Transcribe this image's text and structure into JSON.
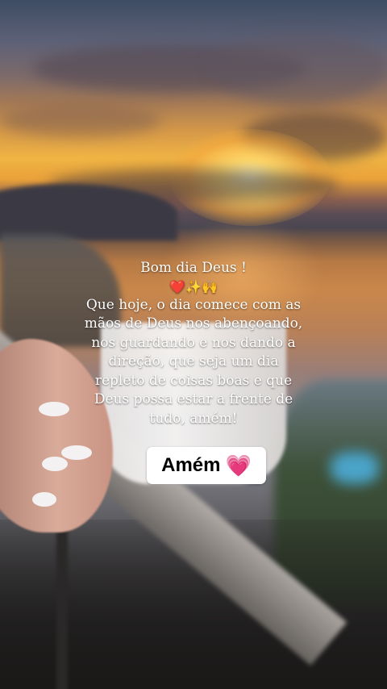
{
  "message": {
    "greeting": "Bom dia Deus !",
    "emojis": {
      "heart": "❤️",
      "sparkles": "✨",
      "raised_hands": "🙌"
    },
    "lines": [
      "Que hoje, o dia comece com as",
      "mãos de Deus nos abençoando,",
      "nos guardando e nos dando a",
      "direção, que seja um dia",
      "repleto de coisas boas e que",
      "Deus possa estar a frente de",
      "tudo, amém!"
    ]
  },
  "amem_button": {
    "label": "Amém",
    "heart": "💗",
    "heart_color": "#ee3f7d"
  },
  "colors": {
    "text": "#ffffff",
    "button_bg": "#ffffff"
  }
}
